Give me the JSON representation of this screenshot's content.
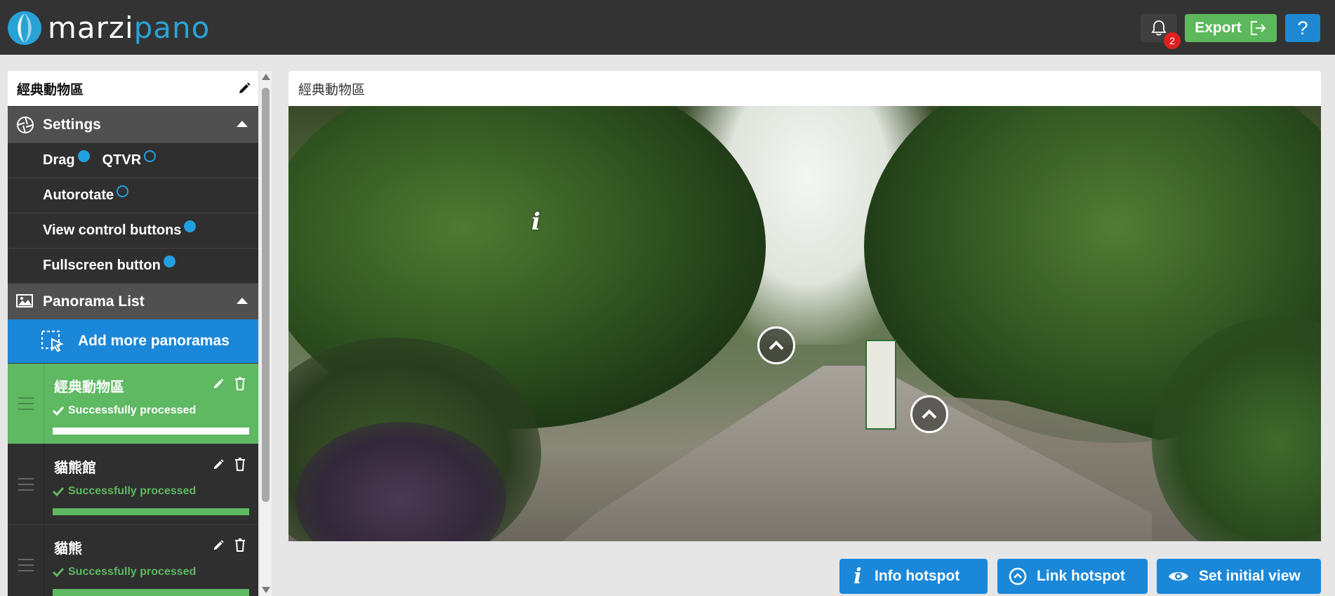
{
  "app": {
    "logo_part1": "marzi",
    "logo_part2": "pano",
    "notification_count": "2",
    "export_label": "Export",
    "help_label": "?"
  },
  "sidebar": {
    "project_title": "經典動物區",
    "settings": {
      "title": "Settings",
      "drag_label": "Drag",
      "drag_on": true,
      "qtvr_label": "QTVR",
      "qtvr_on": false,
      "autorotate_label": "Autorotate",
      "autorotate_on": false,
      "view_control_label": "View control buttons",
      "view_control_on": true,
      "fullscreen_label": "Fullscreen button",
      "fullscreen_on": true
    },
    "panorama_list": {
      "title": "Panorama List",
      "add_label": "Add more panoramas",
      "items": [
        {
          "name": "經典動物區",
          "status": "Successfully processed",
          "progress": 1.0,
          "active": true
        },
        {
          "name": "貓熊館",
          "status": "Successfully processed",
          "progress": 1.0,
          "active": false
        },
        {
          "name": "貓熊",
          "status": "Successfully processed",
          "progress": 1.0,
          "active": false
        }
      ]
    }
  },
  "viewer": {
    "title": "經典動物區",
    "info_hotspot_icon": "info-icon",
    "link_hotspot_icon": "chevron-up-icon"
  },
  "actions": {
    "info_hotspot_label": "Info hotspot",
    "link_hotspot_label": "Link hotspot",
    "initial_view_label": "Set initial view"
  },
  "colors": {
    "topbar": "#333333",
    "accent_blue": "#1b87d8",
    "success_green": "#5cb85c",
    "sidebar_dark": "#2c2c2c",
    "badge_red": "#e02020"
  }
}
